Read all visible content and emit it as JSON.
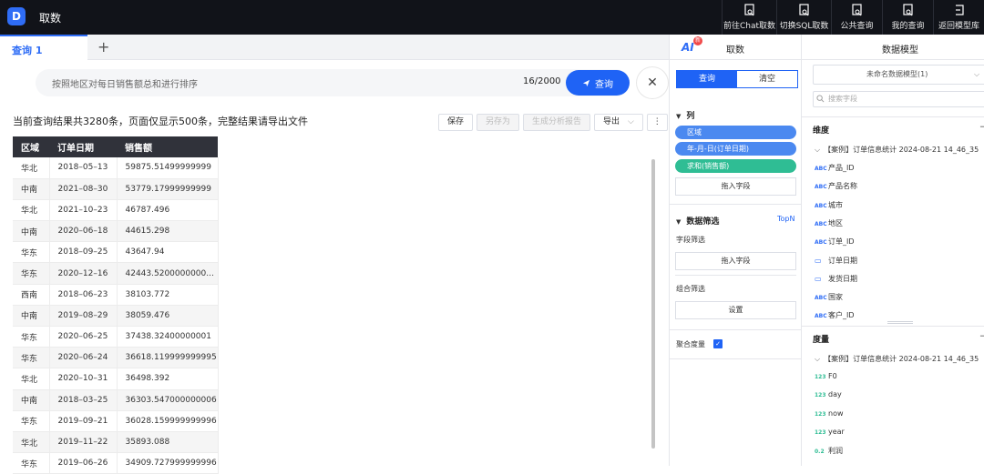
{
  "app": {
    "logo_text": "D",
    "title": "取数"
  },
  "top_actions": [
    {
      "label": "前往Chat取数",
      "icon": "doc-search-icon"
    },
    {
      "label": "切换SQL取数",
      "icon": "doc-search-icon"
    },
    {
      "label": "公共查询",
      "icon": "doc-search-icon"
    },
    {
      "label": "我的查询",
      "icon": "doc-search-icon"
    },
    {
      "label": "返回模型库",
      "icon": "return-icon"
    }
  ],
  "tabs": {
    "active": "查询 1",
    "add": "+"
  },
  "query": {
    "placeholder": "按照地区对每日销售额总和进行排序",
    "counter": "16/2000",
    "submit": "查询",
    "close": "✕"
  },
  "result": {
    "info": "当前查询结果共3280条，页面仅显示500条，完整结果请导出文件",
    "buttons": {
      "save": "保存",
      "save_as": "另存为",
      "generate": "生成分析报告",
      "export": "导出",
      "more": "⋮"
    },
    "columns": [
      "区域",
      "订单日期",
      "销售额"
    ],
    "rows": [
      [
        "华北",
        "2018–05–13",
        "59875.51499999999"
      ],
      [
        "中南",
        "2021–08–30",
        "53779.17999999999"
      ],
      [
        "华北",
        "2021–10–23",
        "46787.496"
      ],
      [
        "中南",
        "2020–06–18",
        "44615.298"
      ],
      [
        "华东",
        "2018–09–25",
        "43647.94"
      ],
      [
        "华东",
        "2020–12–16",
        "42443.5200000000..."
      ],
      [
        "西南",
        "2018–06–23",
        "38103.772"
      ],
      [
        "中南",
        "2019–08–29",
        "38059.476"
      ],
      [
        "华东",
        "2020–06–25",
        "37438.32400000001"
      ],
      [
        "华东",
        "2020–06–24",
        "36618.119999999995"
      ],
      [
        "华北",
        "2020–10–31",
        "36498.392"
      ],
      [
        "中南",
        "2018–03–25",
        "36303.547000000006"
      ],
      [
        "华东",
        "2019–09–21",
        "36028.159999999996"
      ],
      [
        "华北",
        "2019–11–22",
        "35893.088"
      ],
      [
        "华东",
        "2019–06–26",
        "34909.727999999996"
      ]
    ]
  },
  "mid": {
    "ai": "AI",
    "ai_new": "新",
    "title": "取数",
    "seg": {
      "query": "查询",
      "clear": "清空"
    },
    "columns_section": "列",
    "columns": [
      {
        "label": "区域",
        "color": "#4b89f0"
      },
      {
        "label": "年-月-日(订单日期)",
        "color": "#4b89f0"
      },
      {
        "label": "求和(销售额)",
        "color": "#2fbd94"
      }
    ],
    "drag_field": "拖入字段",
    "filter_section": "数据筛选",
    "topn": "TopN",
    "field_filter": "字段筛选",
    "drag_field2": "拖入字段",
    "combo_filter": "组合筛选",
    "settings": "设置",
    "aggregate": "聚合度量"
  },
  "right": {
    "title": "数据模型",
    "model_select": "未命名数据模型(1)",
    "search_placeholder": "搜索字段",
    "dimensions": {
      "title": "维度",
      "group": "【案例】订单信息统计 2024-08-21 14_46_35",
      "items": [
        {
          "type": "ABC",
          "label": "产品_ID"
        },
        {
          "type": "ABC",
          "label": "产品名称"
        },
        {
          "type": "ABC",
          "label": "城市"
        },
        {
          "type": "ABC",
          "label": "地区"
        },
        {
          "type": "ABC",
          "label": "订单_ID"
        },
        {
          "type": "date",
          "label": "订单日期"
        },
        {
          "type": "date",
          "label": "发货日期"
        },
        {
          "type": "ABC",
          "label": "国家"
        },
        {
          "type": "ABC",
          "label": "客户_ID"
        }
      ]
    },
    "measures": {
      "title": "度量",
      "group": "【案例】订单信息统计 2024-08-21 14_46_35",
      "items": [
        {
          "type": "123",
          "label": "F0"
        },
        {
          "type": "123",
          "label": "day"
        },
        {
          "type": "123",
          "label": "now"
        },
        {
          "type": "123",
          "label": "year"
        },
        {
          "type": "0.2",
          "label": "利润"
        }
      ]
    }
  }
}
